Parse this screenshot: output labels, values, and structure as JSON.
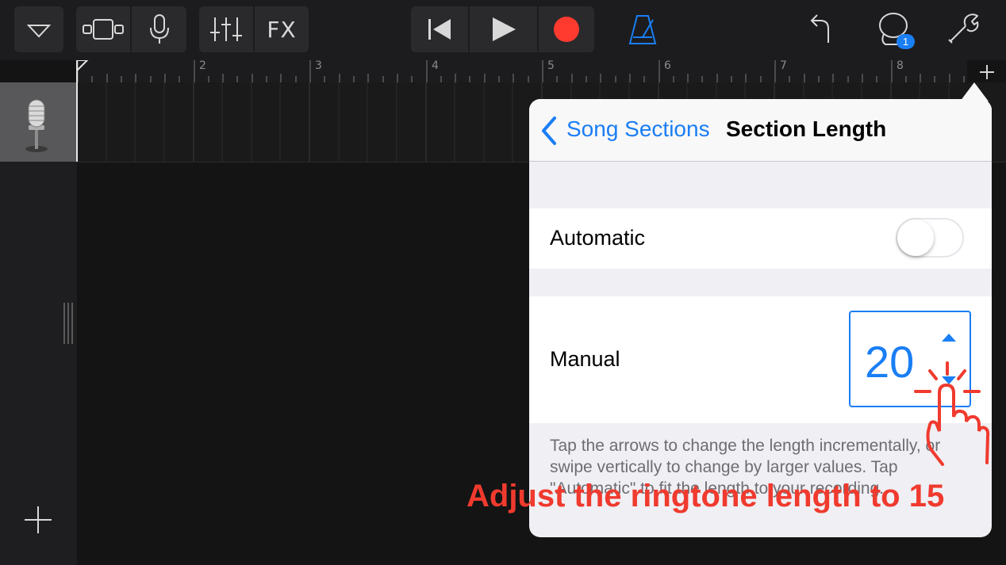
{
  "toolbar": {
    "fx_label": "FX",
    "notification_badge": "1",
    "metronome_color": "#1a7ef5",
    "record_color": "#ff3b30"
  },
  "ruler": {
    "bar_numbers": [
      "2",
      "3",
      "4",
      "5",
      "6",
      "7",
      "8"
    ]
  },
  "popover": {
    "back_label": "Song Sections",
    "title": "Section Length",
    "automatic_label": "Automatic",
    "automatic_on": false,
    "manual_label": "Manual",
    "manual_value": "20",
    "footnote": "Tap the arrows to change the length incrementally, or swipe vertically to change by larger values. Tap \"Automatic\" to fit the length to your recording."
  },
  "annotation": {
    "caption": "Adjust the ringtone length to 15",
    "color": "#f03a2e"
  }
}
